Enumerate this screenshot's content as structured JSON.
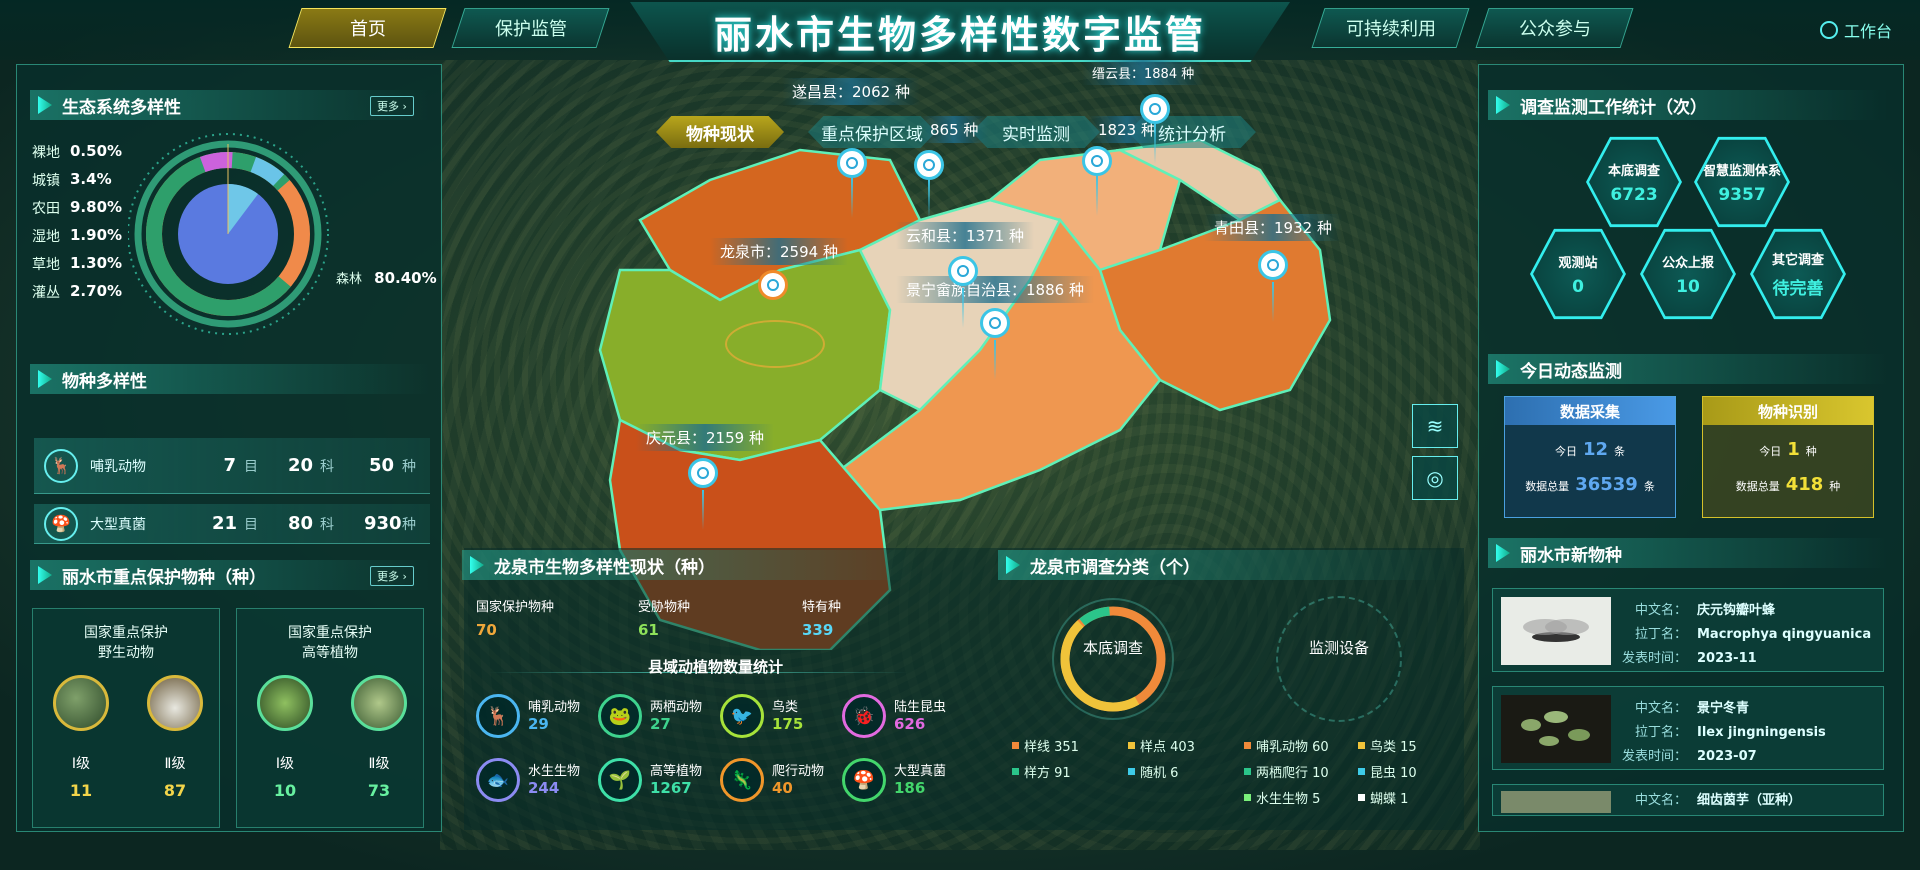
{
  "nav": {
    "tabs": [
      "首页",
      "保护监管",
      "可持续利用",
      "公众参与"
    ],
    "title": "丽水市生物多样性数字监管",
    "workbench": "工作台"
  },
  "eco": {
    "title": "生态系统多样性",
    "more": "更多",
    "items": [
      {
        "name": "裸地",
        "value": "0.50%"
      },
      {
        "name": "城镇",
        "value": "3.4%"
      },
      {
        "name": "农田",
        "value": "9.80%"
      },
      {
        "name": "湿地",
        "value": "1.90%"
      },
      {
        "name": "草地",
        "value": "1.30%"
      },
      {
        "name": "灌丛",
        "value": "2.70%"
      }
    ],
    "forest": {
      "name": "森林",
      "value": "80.40%"
    }
  },
  "species": {
    "title": "物种多样性",
    "rows": [
      {
        "name": "哺乳动物",
        "mu": "7",
        "mu_u": "目",
        "ke": "20",
        "ke_u": "科",
        "zhong": "50",
        "zhong_u": "种"
      },
      {
        "name": "大型真菌",
        "mu": "21",
        "mu_u": "目",
        "ke": "80",
        "ke_u": "科",
        "zhong": "930",
        "zhong_u": "种"
      }
    ]
  },
  "protect": {
    "title": "丽水市重点保护物种（种）",
    "more": "更多",
    "boxes": [
      {
        "title1": "国家重点保护",
        "title2": "野生动物",
        "l1": "Ⅰ级",
        "v1": "11",
        "l2": "Ⅱ级",
        "v2": "87"
      },
      {
        "title1": "国家重点保护",
        "title2": "高等植物",
        "l1": "Ⅰ级",
        "v1": "10",
        "l2": "Ⅱ级",
        "v2": "73"
      }
    ]
  },
  "map": {
    "tabs": [
      "物种现状",
      "重点保护区域",
      "实时监测",
      "统计分析"
    ],
    "labels": {
      "suichang": "遂昌县：2062 种",
      "longquan": "龙泉市：2594 种",
      "yunhe": "云和县：1371 种",
      "jingning": "景宁畲族自治县：1886 种",
      "qingtian": "青田县：1932 种",
      "qingyuan": "庆元县：2159 种",
      "songyang": "865 种",
      "liandu": "1823 种",
      "jinyun": "缙云县：1884 种"
    }
  },
  "lq": {
    "title": "龙泉市生物多样性现状（种）",
    "stats": [
      {
        "label": "国家保护物种",
        "value": "70",
        "color": "#f0a73a"
      },
      {
        "label": "受胁物种",
        "value": "61",
        "color": "#8fe25a"
      },
      {
        "label": "特有种",
        "value": "339",
        "color": "#58d7f7"
      }
    ],
    "sub": "县域动植物数量统计",
    "animals": [
      {
        "name": "哺乳动物",
        "value": "29",
        "color": "#4bb6f0"
      },
      {
        "name": "两栖动物",
        "value": "27",
        "color": "#3ed28e"
      },
      {
        "name": "鸟类",
        "value": "175",
        "color": "#a6e23a"
      },
      {
        "name": "陆生昆虫",
        "value": "626",
        "color": "#e26ae0"
      },
      {
        "name": "水生生物",
        "value": "244",
        "color": "#8b8bf2"
      },
      {
        "name": "高等植物",
        "value": "1267",
        "color": "#3ee0a8"
      },
      {
        "name": "爬行动物",
        "value": "40",
        "color": "#f0962a"
      },
      {
        "name": "大型真菌",
        "value": "186",
        "color": "#43d66c"
      }
    ]
  },
  "survey": {
    "title": "龙泉市调查分类（个）",
    "ring1": "本底调查",
    "ring2": "监测设备",
    "legend": [
      {
        "t": "样线 351",
        "c": "#f08a3a"
      },
      {
        "t": "样点 403",
        "c": "#f0c33a"
      },
      {
        "t": "哺乳动物 60",
        "c": "#f08a3a"
      },
      {
        "t": "鸟类 15",
        "c": "#f0c33a"
      },
      {
        "t": "样方 91",
        "c": "#2bc58a"
      },
      {
        "t": "随机 6",
        "c": "#3ecbe8"
      },
      {
        "t": "两栖爬行 10",
        "c": "#2bc58a"
      },
      {
        "t": "昆虫 10",
        "c": "#3ecbe8"
      },
      {
        "t": "水生生物 5",
        "c": "#7af07a"
      },
      {
        "t": "蝴蝶 1",
        "c": "#ffffff"
      }
    ]
  },
  "work": {
    "title": "调查监测工作统计（次）",
    "hex": [
      {
        "l": "本底调查",
        "v": "6723"
      },
      {
        "l": "智慧监测体系",
        "v": "9357"
      },
      {
        "l": "观测站",
        "v": "0"
      },
      {
        "l": "公众上报",
        "v": "10"
      },
      {
        "l": "其它调查",
        "v": "待完善"
      }
    ]
  },
  "today": {
    "title": "今日动态监测",
    "collect": {
      "title": "数据采集",
      "today_label": "今日",
      "today_value": "12",
      "today_unit": "条",
      "total_label": "数据总量",
      "total_value": "36539",
      "total_unit": "条"
    },
    "identify": {
      "title": "物种识别",
      "today_label": "今日",
      "today_value": "1",
      "today_unit": "种",
      "total_label": "数据总量",
      "total_value": "418",
      "total_unit": "种"
    }
  },
  "newsp": {
    "title": "丽水市新物种",
    "labels": {
      "cn": "中文名：",
      "la": "拉丁名：",
      "time": "发表时间："
    },
    "items": [
      {
        "cn": "庆元钩瓣叶蜂",
        "la": "Macrophya qingyuanica",
        "time": "2023-11"
      },
      {
        "cn": "景宁冬青",
        "la": "Ilex jingningensis",
        "time": "2023-07"
      },
      {
        "cn": "细齿茵芋（亚种）"
      }
    ]
  }
}
